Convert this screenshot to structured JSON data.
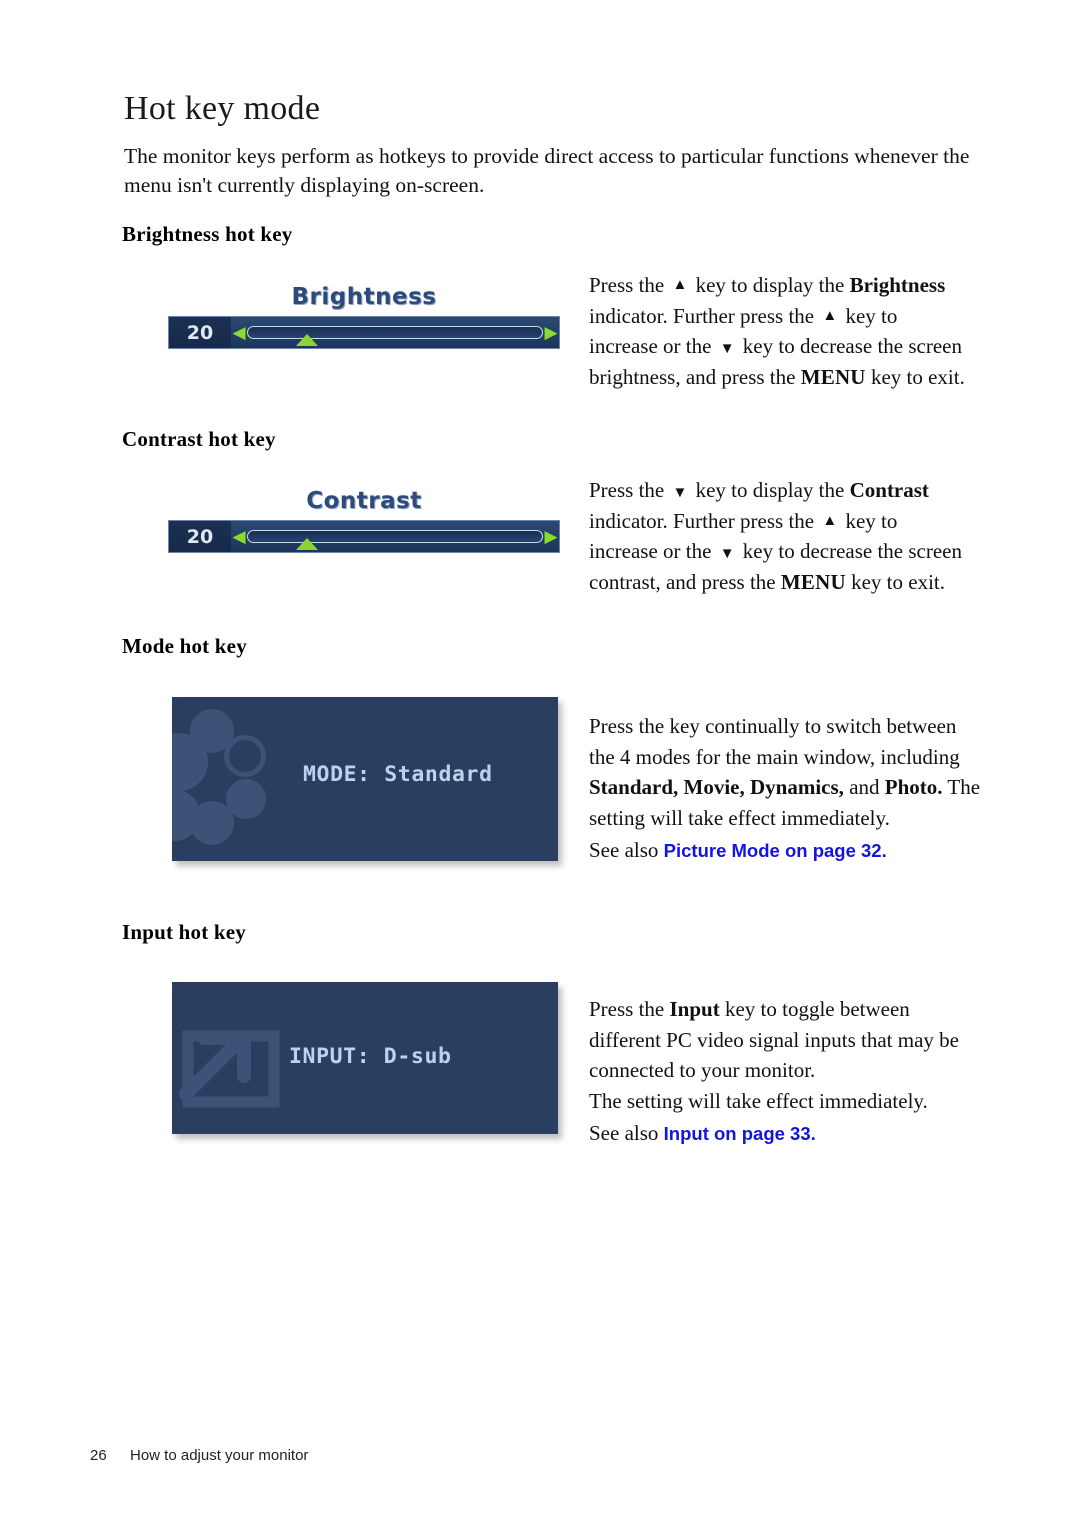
{
  "document": {
    "title": "Hot key mode",
    "intro": "The monitor keys perform as hotkeys to provide direct access to particular functions whenever the menu isn't currently displaying on-screen."
  },
  "sections": {
    "brightness": {
      "heading": "Brightness hot key",
      "osd": {
        "kind": "slider",
        "title": "Brightness",
        "value": "20",
        "left_arrow": "◀",
        "right_arrow": "▶",
        "thumb_percent": 20
      },
      "description": {
        "line1_a": "Press the",
        "line1_key": "up-arrow",
        "line1_b": "key to display the",
        "line1_bold": "Brightness",
        "line2_a": "indicator. Further press the",
        "line2_key": "up-arrow",
        "line2_b": "key to",
        "line3_a": "increase or the",
        "line3_key": "down-arrow",
        "line3_b": "key to decrease the screen",
        "line4_a": "brightness, and press the",
        "line4_bold": "MENU",
        "line4_b": "key to exit."
      }
    },
    "contrast": {
      "heading": "Contrast hot key",
      "osd": {
        "kind": "slider",
        "title": "Contrast",
        "value": "20",
        "left_arrow": "◀",
        "right_arrow": "▶",
        "thumb_percent": 20
      },
      "description": {
        "line1_a": "Press the",
        "line1_key": "down-arrow",
        "line1_b": "key to display the",
        "line1_bold": "Contrast",
        "line2_a": "indicator. Further press the",
        "line2_key": "up-arrow",
        "line2_b": "key to",
        "line3_a": "increase or the",
        "line3_key": "down-arrow",
        "line3_b": "key to decrease the screen",
        "line4_a": "contrast, and press the",
        "line4_bold": "MENU",
        "line4_b": "key to exit."
      }
    },
    "mode": {
      "heading": "Mode hot key",
      "osd": {
        "kind": "panel",
        "label": "MODE: Standard"
      },
      "description": {
        "line1": "Press the key continually to switch between",
        "line2": "the 4 modes for the main window, including",
        "line3_bold": "Standard, Movie, Dynamics,",
        "line3_mid": "and",
        "line3_bold2": "Photo.",
        "line3_tail": "The",
        "line4": "setting will take effect immediately.",
        "seealso_prefix": "See also",
        "seealso_link": "Picture Mode on page 32",
        "seealso_suffix": "."
      }
    },
    "input": {
      "heading": "Input hot key",
      "osd": {
        "kind": "panel",
        "label": "INPUT: D-sub"
      },
      "description": {
        "line1_a": "Press the",
        "line1_bold": "Input",
        "line1_b": "key to toggle between",
        "line2": "different PC video signal inputs that may be",
        "line3": "connected to your monitor.",
        "line4": "The setting will take effect immediately.",
        "seealso_prefix": "See also",
        "seealso_link": "Input on page 33",
        "seealso_suffix": "."
      }
    }
  },
  "footer": {
    "page_number": "26",
    "chapter": "How to adjust your monitor"
  },
  "colors": {
    "link": "#1414e0",
    "osd_panel_bg": "#2a3f5f",
    "osd_panel_text": "#b9d4ee",
    "osd_deco": "#3d5277",
    "osd_bar_bg": "#24406a",
    "osd_accent_green": "#87dd2b",
    "osd_title_fill": "#2d4a7a"
  }
}
